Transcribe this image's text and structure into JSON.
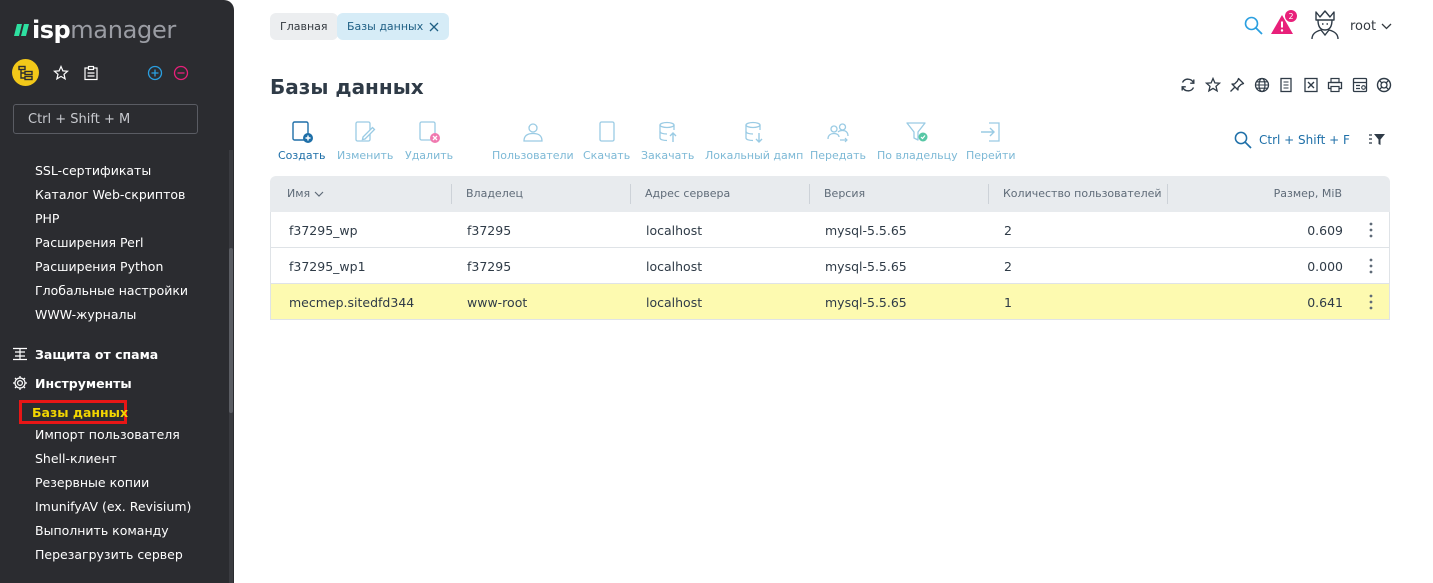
{
  "app": {
    "logo_part1": "isp",
    "logo_part2": "manager"
  },
  "sidebar": {
    "search_placeholder": "Ctrl + Shift + M",
    "items_top": [
      "SSL-сертификаты",
      "Каталог Web-скриптов",
      "PHP",
      "Расширения Perl",
      "Расширения Python",
      "Глобальные настройки",
      "WWW-журналы"
    ],
    "section_spam": "Защита от спама",
    "section_tools": "Инструменты",
    "active_item": "Базы данных",
    "items_tools": [
      "Импорт пользователя",
      "Shell-клиент",
      "Резервные копии",
      "ImunifyAV (ex. Revisium)",
      "Выполнить команду",
      "Перезагрузить сервер"
    ]
  },
  "breadcrumbs": {
    "home": "Главная",
    "current": "Базы данных"
  },
  "header": {
    "alert_count": "2",
    "user": "root"
  },
  "page": {
    "title": "Базы данных"
  },
  "toolbar": {
    "create": "Создать",
    "edit": "Изменить",
    "delete": "Удалить",
    "users": "Пользователи",
    "download": "Скачать",
    "upload": "Закачать",
    "local_dump": "Локальный дамп",
    "transfer": "Передать",
    "by_owner": "По владельцу",
    "goto": "Перейти",
    "search_shortcut": "Ctrl + Shift + F"
  },
  "table": {
    "columns": [
      "Имя",
      "Владелец",
      "Адрес сервера",
      "Версия",
      "Количество пользователей",
      "Размер, MiB"
    ],
    "rows": [
      {
        "name": "f37295_wp",
        "owner": "f37295",
        "server": "localhost",
        "version": "mysql-5.5.65",
        "users": "2",
        "size": "0.609"
      },
      {
        "name": "f37295_wp1",
        "owner": "f37295",
        "server": "localhost",
        "version": "mysql-5.5.65",
        "users": "2",
        "size": "0.000"
      },
      {
        "name": "mecmep.sitedfd344",
        "owner": "www-root",
        "server": "localhost",
        "version": "mysql-5.5.65",
        "users": "1",
        "size": "0.641"
      }
    ]
  },
  "colors": {
    "sidebar_bg": "#2b2c30",
    "accent_yellow": "#f2c819",
    "accent_blue": "#1e6fa8",
    "alert_pink": "#e8207a",
    "selected_row": "#fdfab0"
  }
}
